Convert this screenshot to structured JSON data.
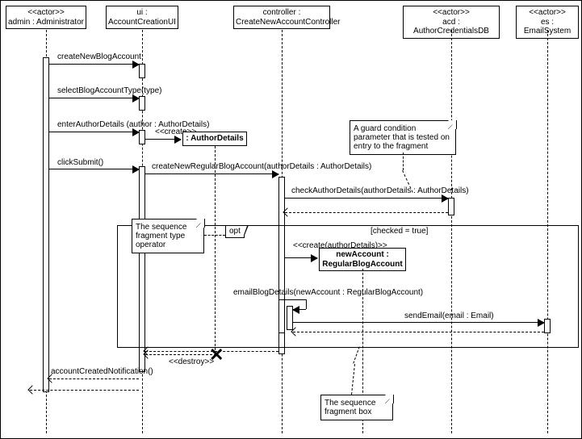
{
  "diagram_type": "UML sequence diagram",
  "lifelines": {
    "admin": {
      "stereotype": "<<actor>>",
      "label": "admin : Administrator"
    },
    "ui": {
      "stereotype": "",
      "label": "ui : AccountCreationUI"
    },
    "adetails": {
      "stereotype": "<<create>>",
      "label": ": AuthorDetails"
    },
    "controller": {
      "stereotype": "",
      "label": "controller : CreateNewAccountController"
    },
    "newacct": {
      "stereotype": "<<create(authorDetails)>>",
      "label1": "newAccount :",
      "label2": "RegularBlogAccount"
    },
    "acd": {
      "stereotype": "<<actor>>",
      "label": "acd : AuthorCredentialsDB"
    },
    "es": {
      "stereotype": "<<actor>>",
      "label": "es : EmailSystem"
    }
  },
  "messages": {
    "m1": "createNewBlogAccount",
    "m2": "selectBlogAccountType(type)",
    "m3": "enterAuthorDetails (author : AuthorDetails)",
    "m4": "clickSubmit()",
    "m5": "createNewRegularBlogAccount(authorDetails : AuthorDetails)",
    "m6": "checkAuthorDetails(authorDetails : AuthorDetails)",
    "m7guard": "[checked = true]",
    "m8": "emailBlogDetails(newAccount : RegularBlogAccount)",
    "m9": "sendEmail(email : Email)",
    "m10": "<<destroy>>",
    "m11": "accountCreatedNotification()"
  },
  "fragment": {
    "operator": "opt"
  },
  "notes": {
    "n1": "A guard condition parameter that is tested on entry to the fragment",
    "n2": "The sequence fragment type operator",
    "n3": "The sequence fragment box"
  }
}
